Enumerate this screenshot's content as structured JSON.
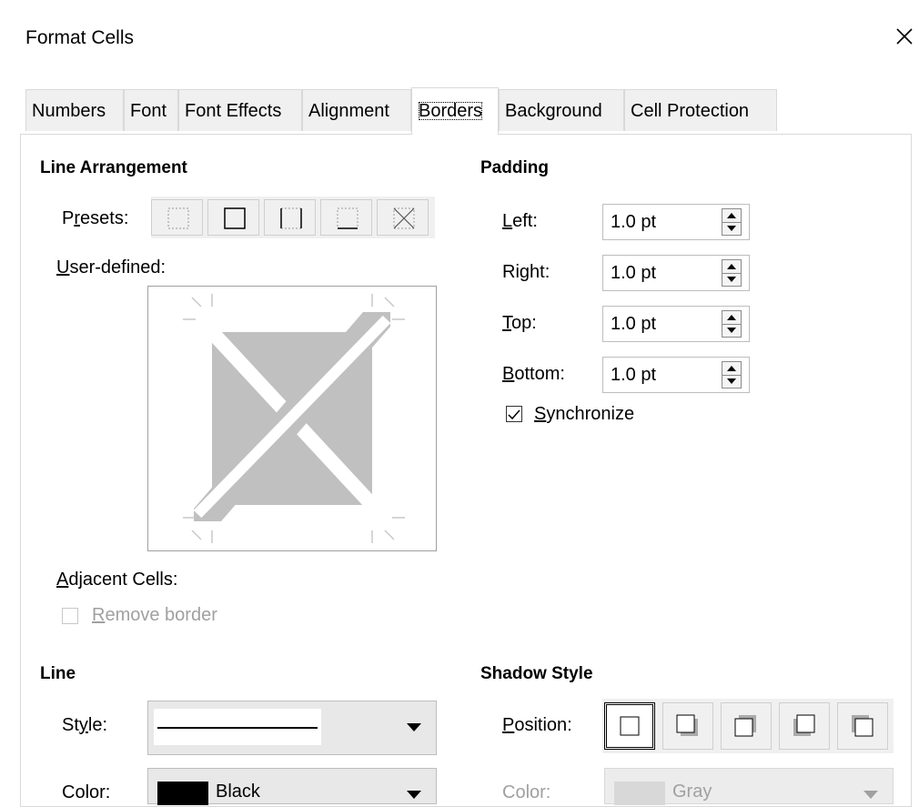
{
  "window": {
    "title": "Format Cells"
  },
  "tabs": [
    {
      "label": "Numbers",
      "active": false
    },
    {
      "label": "Font",
      "active": false
    },
    {
      "label": "Font Effects",
      "active": false
    },
    {
      "label": "Alignment",
      "active": false
    },
    {
      "label": "Borders",
      "active": true
    },
    {
      "label": "Background",
      "active": false
    },
    {
      "label": "Cell Protection",
      "active": false
    }
  ],
  "line_arrangement": {
    "heading": "Line Arrangement",
    "presets_label": "Presets:",
    "presets": [
      "no-borders-icon",
      "outer-border-icon",
      "left-right-border-icon",
      "top-bottom-border-icon",
      "diagonal-border-icon"
    ],
    "user_defined_label": "User-defined:",
    "adjacent_label": "Adjacent Cells:",
    "remove_border_label": "Remove border"
  },
  "padding": {
    "heading": "Padding",
    "fields": [
      {
        "label": "Left:",
        "value": "1.0 pt"
      },
      {
        "label": "Right:",
        "value": "1.0 pt"
      },
      {
        "label": "Top:",
        "value": "1.0 pt"
      },
      {
        "label": "Bottom:",
        "value": "1.0 pt"
      }
    ],
    "synchronize_label": "Synchronize",
    "synchronize_checked": true
  },
  "line": {
    "heading": "Line",
    "style_label": "Style:",
    "color_label": "Color:",
    "color_value": "Black"
  },
  "shadow": {
    "heading": "Shadow Style",
    "position_label": "Position:",
    "positions": [
      "no-shadow-icon",
      "shadow-bottom-right-icon",
      "shadow-top-right-icon",
      "shadow-bottom-left-icon",
      "shadow-top-left-icon"
    ],
    "color_label": "Color:",
    "color_value": "Gray"
  },
  "colors": {
    "accent_gray": "#c0c0c0",
    "black": "#000000",
    "gray": "#c8c8c8"
  }
}
